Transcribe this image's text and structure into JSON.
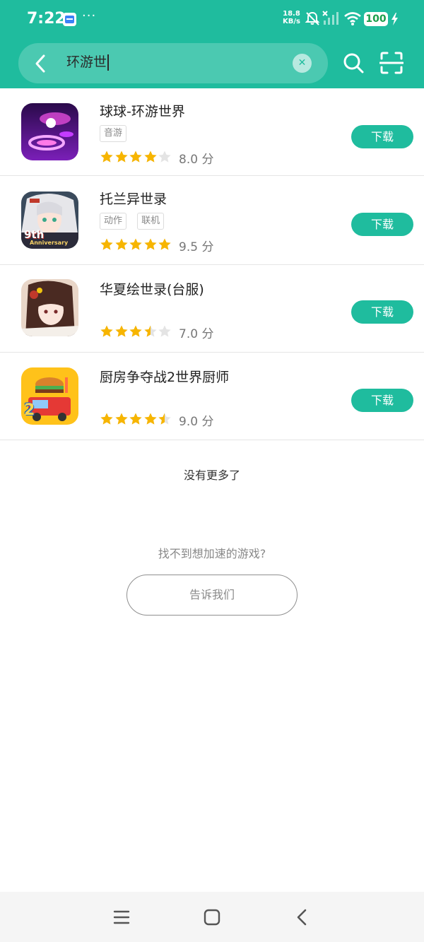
{
  "status_bar": {
    "time": "7:22",
    "dots": "···",
    "net_speed_value": "18.8",
    "net_speed_unit": "KB/s",
    "battery": "100"
  },
  "search": {
    "query": "环游世"
  },
  "games": [
    {
      "name": "球球-环游世界",
      "tags": [
        "音游"
      ],
      "rating": 4.0,
      "score": "8.0 分",
      "button": "下载"
    },
    {
      "name": "托兰异世录",
      "tags": [
        "动作",
        "联机"
      ],
      "rating": 5.0,
      "score": "9.5 分",
      "button": "下载"
    },
    {
      "name": "华夏绘世录(台服)",
      "tags": [],
      "rating": 3.5,
      "score": "7.0 分",
      "button": "下载"
    },
    {
      "name": "厨房争夺战2世界厨师",
      "tags": [],
      "rating": 4.5,
      "score": "9.0 分",
      "button": "下载"
    }
  ],
  "footer": {
    "no_more": "没有更多了",
    "not_found": "找不到想加速的游戏?",
    "tell_us": "告诉我们"
  },
  "icon_texts": {
    "anniversary_number": "9th",
    "anniversary_word": "Anniversary",
    "kitchen_number": "2"
  },
  "colors": {
    "accent": "#1fbc9e",
    "star": "#f7b500",
    "star_empty": "#e4e4e4"
  }
}
